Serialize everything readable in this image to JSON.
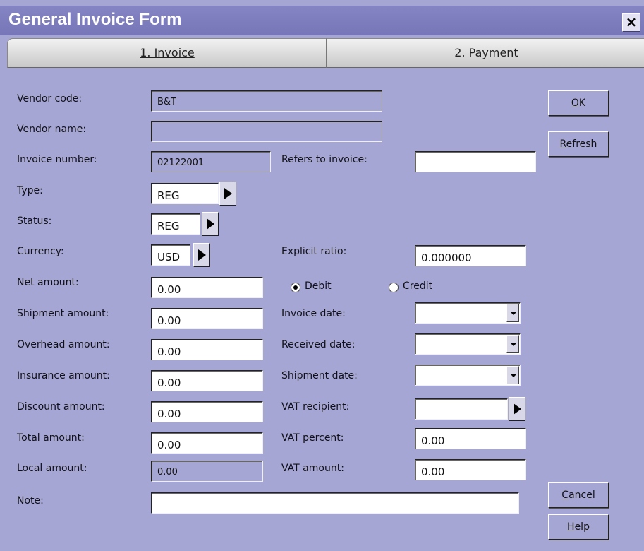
{
  "window": {
    "title": "General Invoice Form",
    "close_glyph": "×"
  },
  "tabs": [
    {
      "label": "1. Invoice",
      "active": true
    },
    {
      "label": "2. Payment",
      "active": false
    }
  ],
  "left_labels": {
    "vendor_code": "Vendor code:",
    "vendor_name": "Vendor name:",
    "invoice_number": "Invoice number:",
    "type": "Type:",
    "status": "Status:",
    "currency": "Currency:",
    "net_amount": "Net amount:",
    "shipment_amount": "Shipment amount:",
    "overhead_amount": "Overhead amount:",
    "insurance_amount": "Insurance amount:",
    "discount_amount": "Discount amount:",
    "total_amount": "Total amount:",
    "local_amount": "Local amount:",
    "note": "Note:"
  },
  "left_values": {
    "vendor_code": "B&T",
    "vendor_name": "",
    "invoice_number": "02122001",
    "type": "REG",
    "status": "REG",
    "currency": "USD",
    "net_amount": "0.00",
    "shipment_amount": "0.00",
    "overhead_amount": "0.00",
    "insurance_amount": "0.00",
    "discount_amount": "0.00",
    "total_amount": "0.00",
    "local_amount": "0.00",
    "note": ""
  },
  "right_labels": {
    "refers_to_invoice": "Refers to invoice:",
    "explicit_ratio": "Explicit ratio:",
    "invoice_date": "Invoice date:",
    "received_date": "Received date:",
    "shipment_date": "Shipment date:",
    "vat_recipient": "VAT recipient:",
    "vat_percent": "VAT percent:",
    "vat_amount": "VAT amount:"
  },
  "right_values": {
    "refers_to_invoice": "",
    "explicit_ratio": "0.000000",
    "invoice_date": "",
    "received_date": "",
    "shipment_date": "",
    "vat_recipient": "",
    "vat_percent": "0.00",
    "vat_amount": "0.00"
  },
  "radios": {
    "debit": {
      "label": "Debit",
      "selected": true
    },
    "credit": {
      "label": "Credit",
      "selected": false
    }
  },
  "buttons": {
    "ok": {
      "label": "OK",
      "mnemonic": "O"
    },
    "refresh": {
      "label": "Refresh",
      "mnemonic": "R"
    },
    "cancel": {
      "label": "Cancel",
      "mnemonic": "C"
    },
    "help": {
      "label": "Help",
      "mnemonic": "H"
    }
  },
  "icons": {
    "lookup": "right-triangle-arrow-icon",
    "dropdown": "chevron-down-icon",
    "close": "close-icon"
  },
  "colors": {
    "window_bg": "#a6a6d4",
    "titlebar": "#7a7abc",
    "title_text": "#ffffff"
  }
}
